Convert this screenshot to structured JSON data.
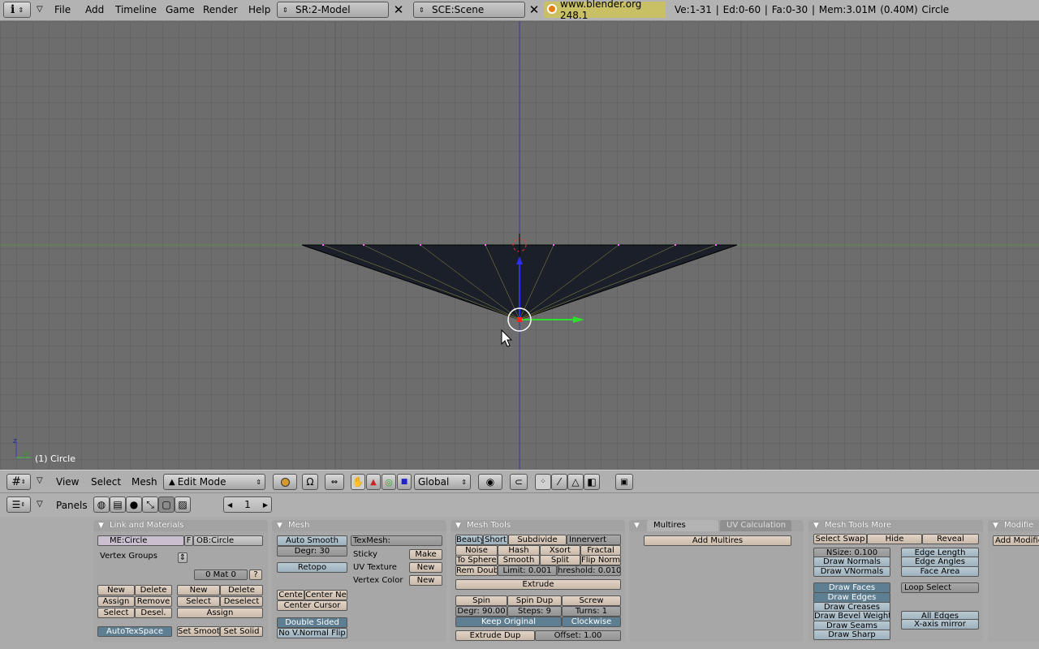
{
  "header": {
    "menus": [
      "File",
      "Add",
      "Timeline",
      "Game",
      "Render",
      "Help"
    ],
    "screen_field": "SR:2-Model",
    "scene_field": "SCE:Scene",
    "url": "www.blender.org 248.1",
    "stats": "Ve:1-31 | Ed:0-60 | Fa:0-30 | Mem:3.01M (0.40M) Circle"
  },
  "viewport": {
    "object_label": "(1) Circle"
  },
  "view3d_header": {
    "menus": [
      "View",
      "Select",
      "Mesh"
    ],
    "mode": "Edit Mode",
    "orientation": "Global"
  },
  "buttons_header": {
    "panels_label": "Panels",
    "frame": "1"
  },
  "link_materials": {
    "title": "Link and Materials",
    "me": "ME:Circle",
    "f": "F",
    "ob": "OB:Circle",
    "vertex_groups": "Vertex Groups",
    "mat": "0 Mat 0",
    "q": "?",
    "new": "New",
    "delete": "Delete",
    "assign": "Assign",
    "remove": "Remove",
    "select": "Select",
    "desel": "Desel.",
    "new2": "New",
    "delete2": "Delete",
    "select2": "Select",
    "deselect2": "Deselect",
    "assign2": "Assign",
    "autotex": "AutoTexSpace",
    "set_smooth": "Set Smoot",
    "set_solid": "Set Solid"
  },
  "mesh": {
    "title": "Mesh",
    "auto_smooth": "Auto Smooth",
    "degr": "Degr: 30",
    "retopo": "Retopo",
    "centre": "Cente",
    "centre_new": "Center Ne",
    "centre_cursor": "Center Cursor",
    "double_sided": "Double Sided",
    "no_vnormal_flip": "No V.Normal Flip",
    "texmesh": "TexMesh:",
    "sticky": "Sticky",
    "make": "Make",
    "uv_texture": "UV Texture",
    "new_uv": "New",
    "vertex_color": "Vertex Color",
    "new_vc": "New"
  },
  "mesh_tools": {
    "title": "Mesh Tools",
    "beauty": "Beauty",
    "short": "Short",
    "subdivide": "Subdivide",
    "innervert": "Innervert",
    "noise": "Noise",
    "hash": "Hash",
    "xsort": "Xsort",
    "fractal": "Fractal",
    "to_sphere": "To Sphere",
    "smooth": "Smooth",
    "split": "Split",
    "flip_normals": "Flip Norma",
    "rem_doubles": "Rem Doub",
    "limit": "Limit: 0.001",
    "threshold": "hreshold: 0.010",
    "extrude": "Extrude",
    "spin": "Spin",
    "spin_dup": "Spin Dup",
    "screw": "Screw",
    "degr": "Degr: 90.00",
    "steps": "Steps: 9",
    "turns": "Turns: 1",
    "keep_original": "Keep Original",
    "clockwise": "Clockwise",
    "extrude_dup": "Extrude Dup",
    "offset": "Offset: 1.00"
  },
  "multires": {
    "tab1": "Multires",
    "tab2": "UV Calculation",
    "add": "Add Multires"
  },
  "mesh_tools_more": {
    "title": "Mesh Tools More",
    "select_swap": "Select Swap",
    "hide": "Hide",
    "reveal": "Reveal",
    "nsize": "NSize: 0.100",
    "draw_normals": "Draw Normals",
    "draw_vnormals": "Draw VNormals",
    "edge_length": "Edge Length",
    "edge_angles": "Edge Angles",
    "face_area": "Face Area",
    "draw_faces": "Draw Faces",
    "draw_edges": "Draw Edges",
    "draw_creases": "Draw Creases",
    "draw_bevel": "Draw Bevel Weights",
    "draw_seams": "Draw Seams",
    "draw_sharp": "Draw Sharp",
    "loop_select": "Loop Select",
    "all_edges": "All Edges",
    "x_mirror": "X-axis mirror"
  },
  "modifiers": {
    "title": "Modifie",
    "add": "Add Modifie"
  }
}
